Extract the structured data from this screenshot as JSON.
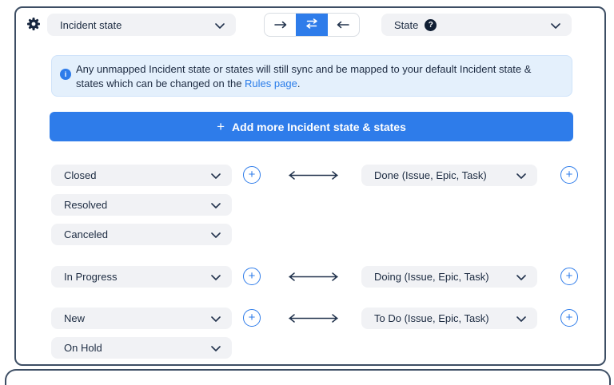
{
  "colors": {
    "accent_blue": "#2e7cea",
    "dark_navy": "#1c2b41",
    "card_border": "#3d4e64",
    "pill_bg": "#f1f2f5",
    "banner_bg": "#e4f0fc",
    "link_blue": "#2b7de9"
  },
  "header": {
    "source_field": {
      "label": "Incident state"
    },
    "target_field": {
      "label": "State"
    },
    "direction_toggle": {
      "options": [
        "right",
        "bidirectional",
        "left"
      ],
      "active": "bidirectional"
    }
  },
  "banner": {
    "text": "Any unmapped Incident state or states will still sync and be mapped to your default Incident state & states which can be changed on the ",
    "link": "Rules page",
    "suffix": "."
  },
  "add_button": {
    "label": "Add more Incident state & states"
  },
  "mappings": [
    {
      "left": [
        "Closed",
        "Resolved",
        "Canceled"
      ],
      "right": "Done (Issue, Epic, Task)"
    },
    {
      "left": [
        "In Progress"
      ],
      "right": "Doing (Issue, Epic, Task)"
    },
    {
      "left": [
        "New",
        "On Hold"
      ],
      "right": "To Do (Issue, Epic, Task)"
    }
  ],
  "icons": {
    "plus_glyph": "+",
    "question_glyph": "?",
    "info_glyph": "i"
  }
}
